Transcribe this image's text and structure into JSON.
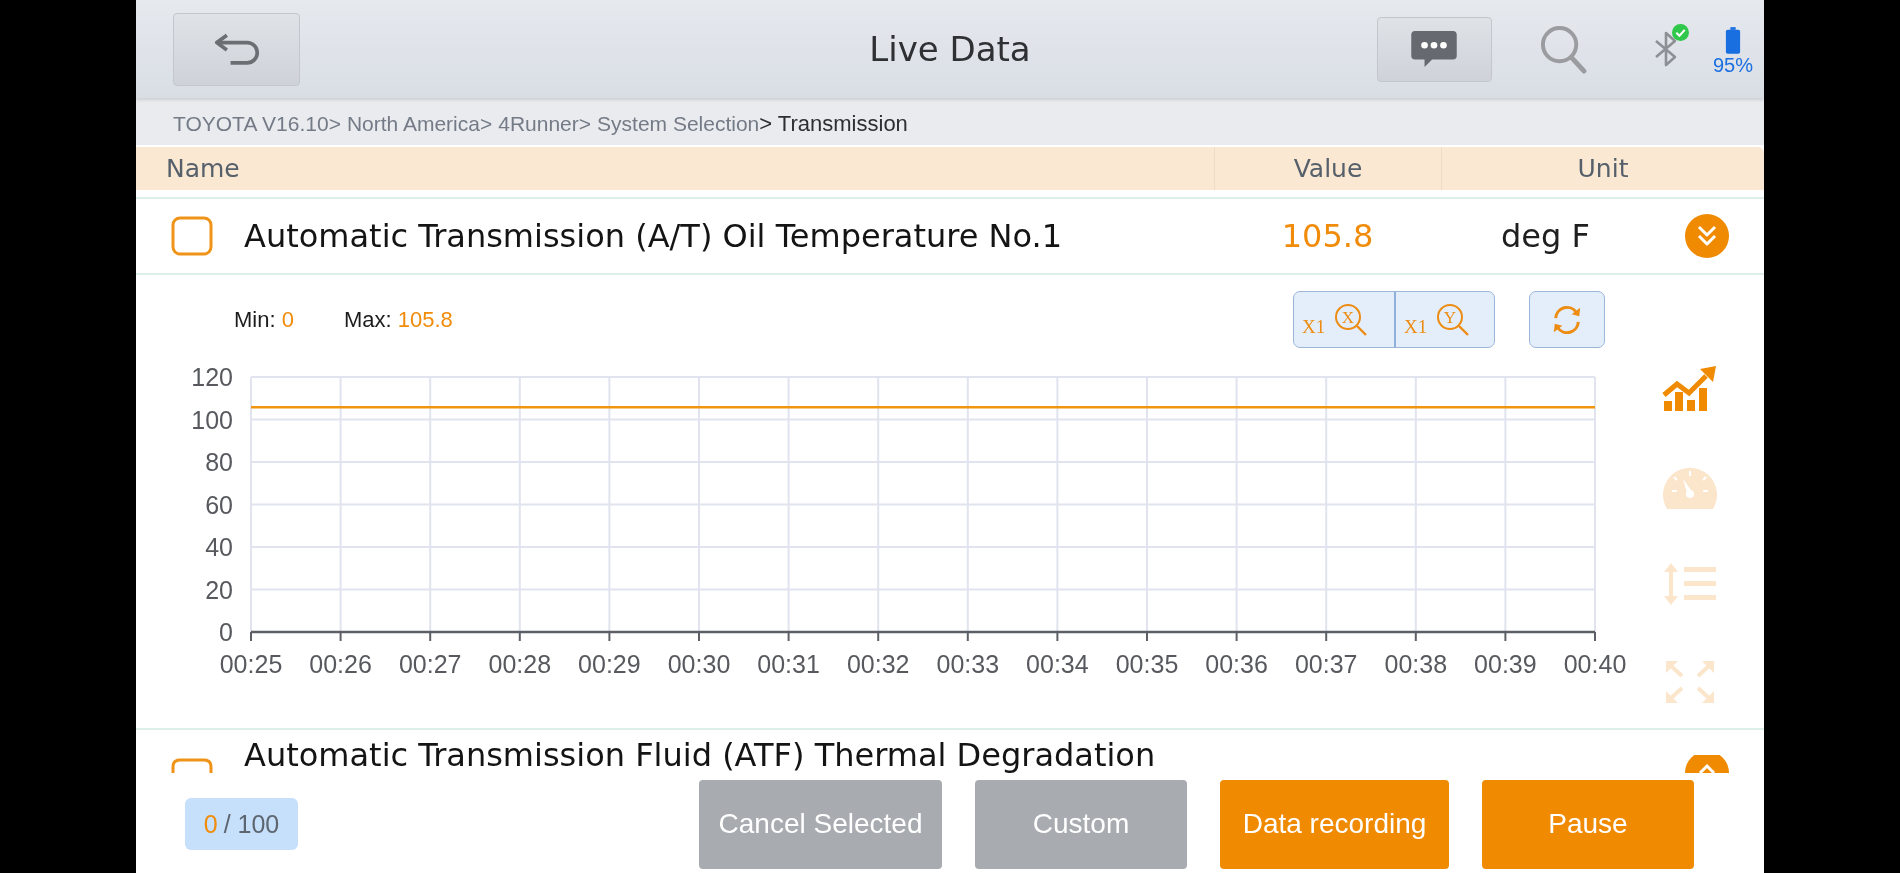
{
  "header": {
    "title": "Live Data"
  },
  "status": {
    "bluetooth_connected": true,
    "battery": "95%"
  },
  "breadcrumb": [
    {
      "label": "TOYOTA V16.10>",
      "current": false
    },
    {
      "label": "North America>",
      "current": false
    },
    {
      "label": "4Runner>",
      "current": false
    },
    {
      "label": "System Selection",
      "current": false
    },
    {
      "label": "> Transmission",
      "current": true
    }
  ],
  "table": {
    "columns": [
      "Name",
      "Value",
      "Unit"
    ]
  },
  "rows": [
    {
      "name": "Automatic Transmission (A/T) Oil Temperature No.1",
      "value": "105.8",
      "unit": "deg F",
      "checked": false,
      "expanded": true,
      "detail": {
        "min": {
          "label": "Min:",
          "value": "0"
        },
        "max": {
          "label": "Max:",
          "value": "105.8"
        },
        "zoom_buttons": [
          {
            "factor": "X1",
            "axis": "X"
          },
          {
            "factor": "X1",
            "axis": "Y"
          }
        ],
        "chart_data": {
          "type": "line",
          "categories": [
            "00:25",
            "00:26",
            "00:27",
            "00:28",
            "00:29",
            "00:30",
            "00:31",
            "00:32",
            "00:33",
            "00:34",
            "00:35",
            "00:36",
            "00:37",
            "00:38",
            "00:39",
            "00:40"
          ],
          "series": [
            {
              "color": "#f0950f",
              "values": [
                105.8,
                105.8,
                105.8,
                105.8,
                105.8,
                105.8,
                105.8,
                105.8,
                105.8,
                105.8,
                105.8,
                105.8,
                105.8,
                105.8,
                105.8,
                105.8
              ]
            }
          ],
          "ylim": [
            0,
            120
          ],
          "yticks": [
            0,
            20,
            40,
            60,
            80,
            100,
            120
          ],
          "grid": true
        },
        "view_modes": [
          {
            "kind": "trend",
            "selected": true
          },
          {
            "kind": "gauge",
            "selected": false
          },
          {
            "kind": "list",
            "selected": false
          },
          {
            "kind": "fullscreen",
            "selected": false
          }
        ]
      }
    },
    {
      "name": "Automatic Transmission Fluid (ATF) Thermal Degradation",
      "checked": false,
      "expanded": false
    }
  ],
  "selection_counter": {
    "count": "0",
    "limit": "/ 100"
  },
  "buttons": [
    {
      "label": "Cancel Selected",
      "kind": "secondary"
    },
    {
      "label": "Custom",
      "kind": "secondary"
    },
    {
      "label": "Data recording",
      "kind": "primary"
    },
    {
      "label": "Pause",
      "kind": "primary"
    }
  ]
}
